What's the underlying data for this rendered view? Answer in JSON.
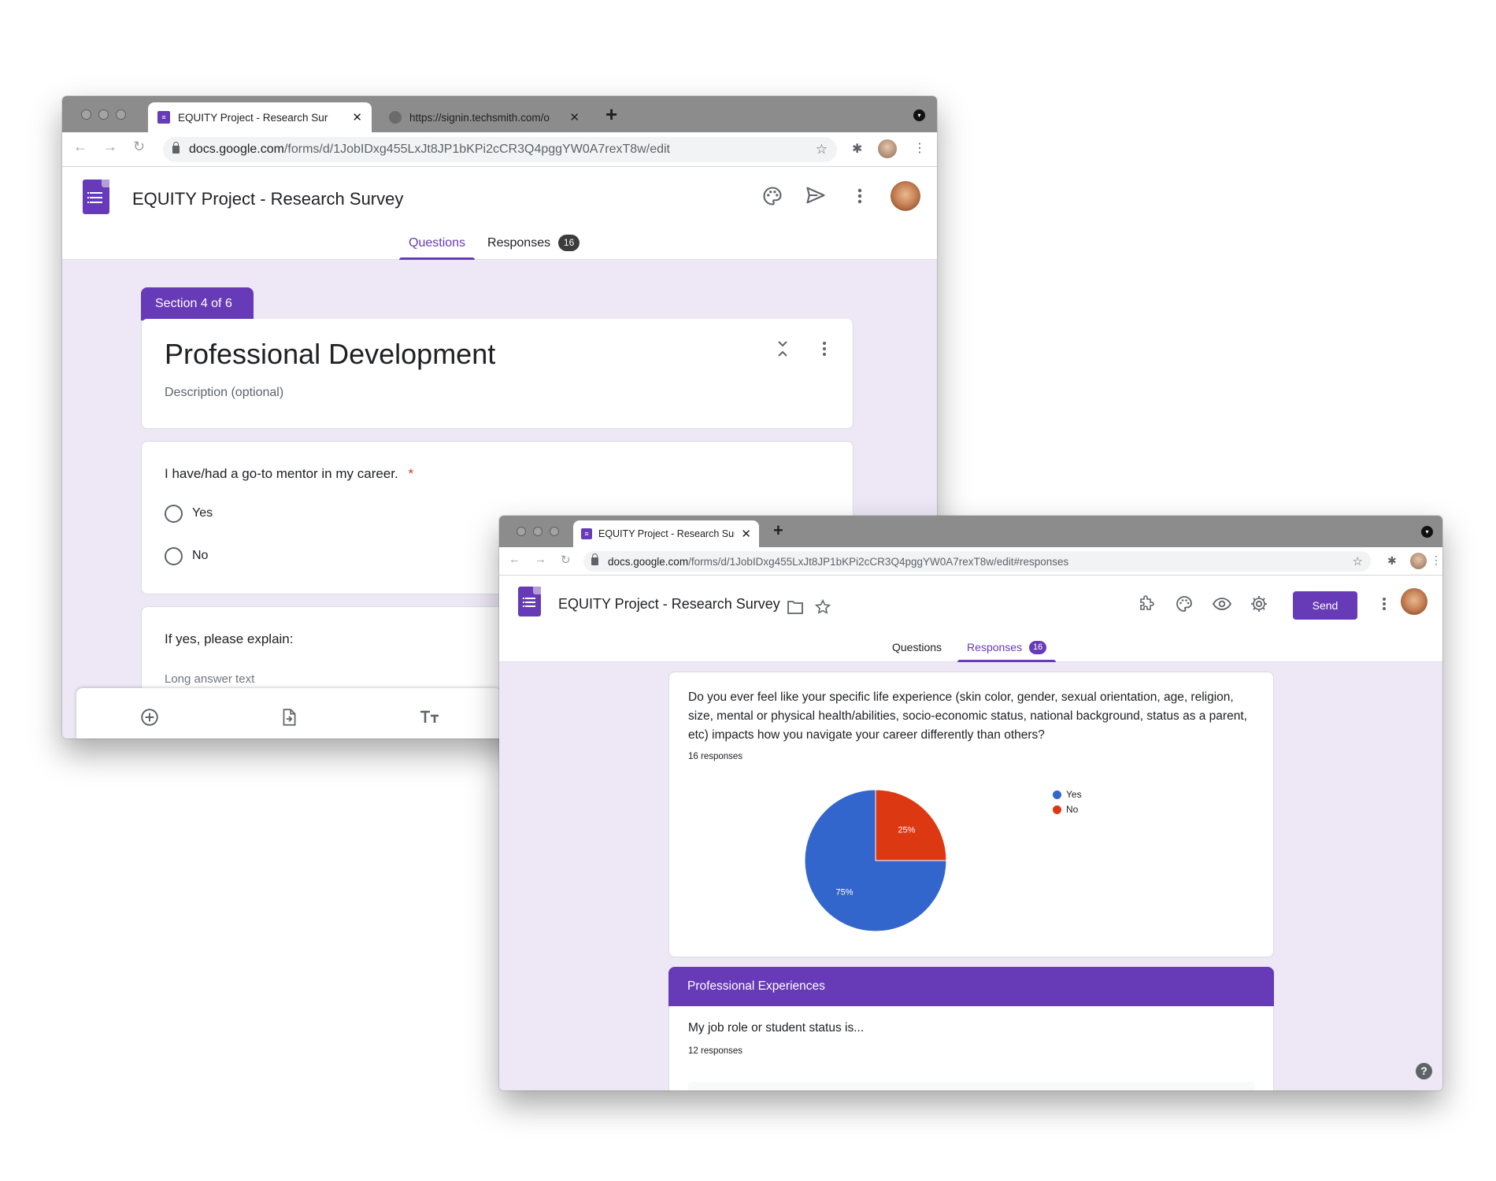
{
  "window1": {
    "tabs": [
      {
        "title": "EQUITY Project - Research Sur",
        "active": true
      },
      {
        "title": "https://signin.techsmith.com/o",
        "active": false
      }
    ],
    "url": {
      "host": "docs.google.com",
      "path": "/forms/d/1JobIDxg455LxJt8JP1bKPi2cCR3Q4pggYW0A7rexT8w/edit"
    },
    "form_title": "EQUITY Project - Research Survey",
    "form_tabs": {
      "questions": "Questions",
      "responses": "Responses",
      "responses_count": "16"
    },
    "section_tag": "Section 4 of 6",
    "section_title": "Professional Development",
    "section_description_placeholder": "Description (optional)",
    "question1": {
      "text": "I have/had a go-to mentor in my career.",
      "required_mark": "*",
      "options": [
        "Yes",
        "No"
      ]
    },
    "question2": {
      "text": "If yes, please explain:",
      "answer_placeholder": "Long answer text"
    },
    "icons": {
      "palette": "palette-icon",
      "send": "send-icon",
      "more": "more-vert-icon",
      "add": "add-circle-icon",
      "import": "import-questions-icon",
      "title": "add-title-icon"
    }
  },
  "window2": {
    "tabs": [
      {
        "title": "EQUITY Project - Research Sur",
        "active": true
      }
    ],
    "url": {
      "host": "docs.google.com",
      "path": "/forms/d/1JobIDxg455LxJt8JP1bKPi2cCR3Q4pggYW0A7rexT8w/edit#responses"
    },
    "form_title": "EQUITY Project - Research Survey",
    "form_tabs": {
      "questions": "Questions",
      "responses": "Responses",
      "responses_count": "16"
    },
    "send_label": "Send",
    "question_card": {
      "text": "Do you ever feel like your specific life experience (skin color, gender, sexual orientation, age, religion, size, mental or physical health/abilities, socio-economic status, national background, status as a parent, etc) impacts how you navigate your career differently than others?",
      "responses_label": "16 responses"
    },
    "section_header": "Professional Experiences",
    "question2": {
      "text": "My job role or student status is...",
      "responses_label": "12 responses"
    },
    "help": "?"
  },
  "chart_data": {
    "type": "pie",
    "labels": [
      "Yes",
      "No"
    ],
    "values": [
      75,
      25
    ],
    "value_labels": [
      "75%",
      "25%"
    ],
    "colors": [
      "#3366cc",
      "#dc3912"
    ],
    "legend_position": "right"
  },
  "colors": {
    "accent": "#673ab7",
    "canvas": "#ede7f6",
    "chrome_tab_strip": "#8c8c8c"
  }
}
